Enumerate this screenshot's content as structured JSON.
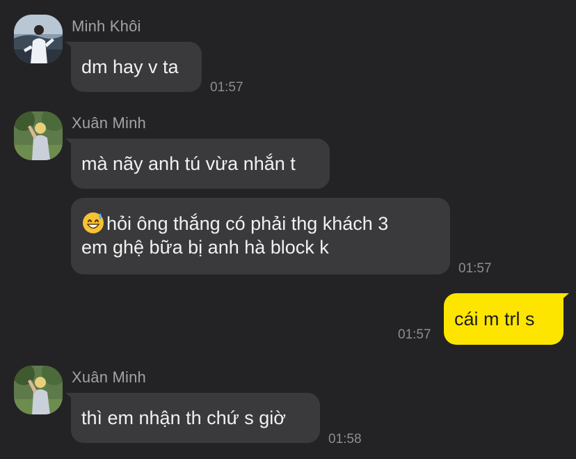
{
  "messages": [
    {
      "sender": "Minh Khôi",
      "avatar_icon": "profile-photo-icon",
      "bubbles": [
        {
          "text": "dm hay v ta",
          "time": "01:57"
        }
      ]
    },
    {
      "sender": "Xuân Minh",
      "avatar_icon": "profile-photo-icon",
      "bubbles": [
        {
          "text": "mà nãy anh tú vừa nhắn t"
        },
        {
          "emoji": "grinning-sweat-emoji",
          "line1": "hỏi ông thắng có phải thg khách 3",
          "line2": "em ghệ bữa bị anh hà block k",
          "time": "01:57"
        }
      ]
    },
    {
      "sender": "me",
      "bubbles": [
        {
          "text": "cái m trl s",
          "time": "01:57"
        }
      ]
    },
    {
      "sender": "Xuân Minh",
      "avatar_icon": "profile-photo-icon",
      "bubbles": [
        {
          "text": "thì em nhận th chứ s giờ",
          "time": "01:58"
        }
      ]
    }
  ],
  "colors": {
    "background": "#232325",
    "incoming_bubble": "#3a3a3c",
    "outgoing_bubble": "#fee500",
    "name_text": "#a3a3a6",
    "time_text": "#8e8e92"
  }
}
